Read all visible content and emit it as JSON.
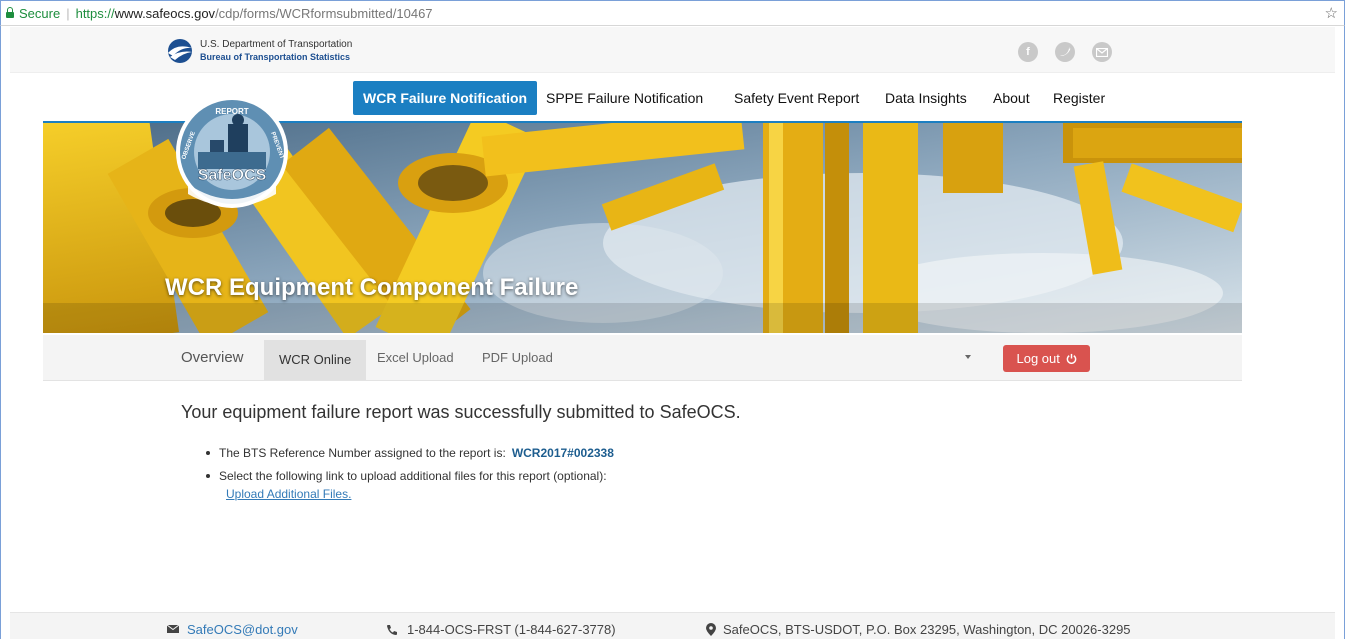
{
  "browser": {
    "secure_label": "Secure",
    "url_protocol": "https://",
    "url_host": "www.safeocs.gov",
    "url_path": "/cdp/forms/WCRformsubmitted/10467"
  },
  "agency": {
    "line1": "U.S. Department of Transportation",
    "line2": "Bureau of Transportation Statistics"
  },
  "social": [
    "facebook-icon",
    "twitter-icon",
    "email-icon"
  ],
  "nav": {
    "items": [
      {
        "label": "WCR Failure Notification",
        "active": true
      },
      {
        "label": "SPPE Failure Notification"
      },
      {
        "label": "Safety Event Report"
      },
      {
        "label": "Data Insights"
      },
      {
        "label": "About"
      },
      {
        "label": "Register"
      }
    ]
  },
  "badge": {
    "top": "REPORT",
    "left": "OBSERVE",
    "right": "PREVENT",
    "name": "SafeOCS"
  },
  "hero": {
    "title": "WCR Equipment Component Failure"
  },
  "subnav": {
    "overview": "Overview",
    "wcr_online": "WCR Online",
    "excel_upload": "Excel Upload",
    "pdf_upload": "PDF Upload",
    "logout": "Log out"
  },
  "content": {
    "heading": "Your equipment failure report was successfully submitted to SafeOCS.",
    "ref_text": "The BTS Reference Number assigned to the report is:",
    "ref_number": "WCR2017#002338",
    "upload_text": "Select the following link to upload additional files for this report (optional):",
    "upload_link": "Upload Additional Files."
  },
  "footer": {
    "email": "SafeOCS@dot.gov",
    "phone": "1-844-OCS-FRST (1-844-627-3778)",
    "address": "SafeOCS, BTS-USDOT, P.O. Box 23295, Washington, DC 20026-3295"
  },
  "colors": {
    "brand_blue": "#1b7fc2",
    "logout_red": "#d9534f",
    "platform_yellow": "#f2c01c"
  }
}
